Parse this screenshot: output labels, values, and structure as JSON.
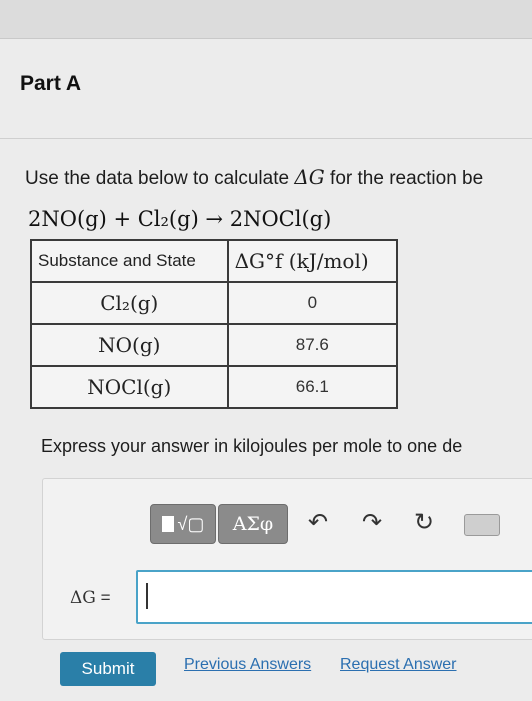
{
  "part": {
    "title": "Part A"
  },
  "prompt": {
    "text": "Use the data below to calculate ",
    "symbol": "ΔG",
    "text_after": " for the reaction be"
  },
  "equation": {
    "text": "2NO(g) + Cl₂(g) → 2NOCl(g)"
  },
  "table": {
    "headers": [
      "Substance and State",
      "ΔG°f (kJ/mol)"
    ],
    "rows": [
      {
        "substance": "Cl₂(g)",
        "value": "0"
      },
      {
        "substance": "NO(g)",
        "value": "87.6"
      },
      {
        "substance": "NOCl(g)",
        "value": "66.1"
      }
    ]
  },
  "instruction": {
    "text": "Express your answer in kilojoules per mole to one de"
  },
  "toolbar": {
    "greek_label": "ΑΣφ",
    "icons": [
      "templates-icon",
      "greek-icon",
      "undo-icon",
      "redo-icon",
      "reset-icon",
      "keyboard-icon"
    ]
  },
  "answer": {
    "label": "ΔG",
    "equals": " =",
    "value": ""
  },
  "actions": {
    "submit_label": "Submit",
    "previous_label": "Previous Answers",
    "request_label": "Request Answer"
  },
  "colors": {
    "submit": "#2a7fa8",
    "link": "#2b6fb0",
    "input_border": "#4aa3c8"
  }
}
